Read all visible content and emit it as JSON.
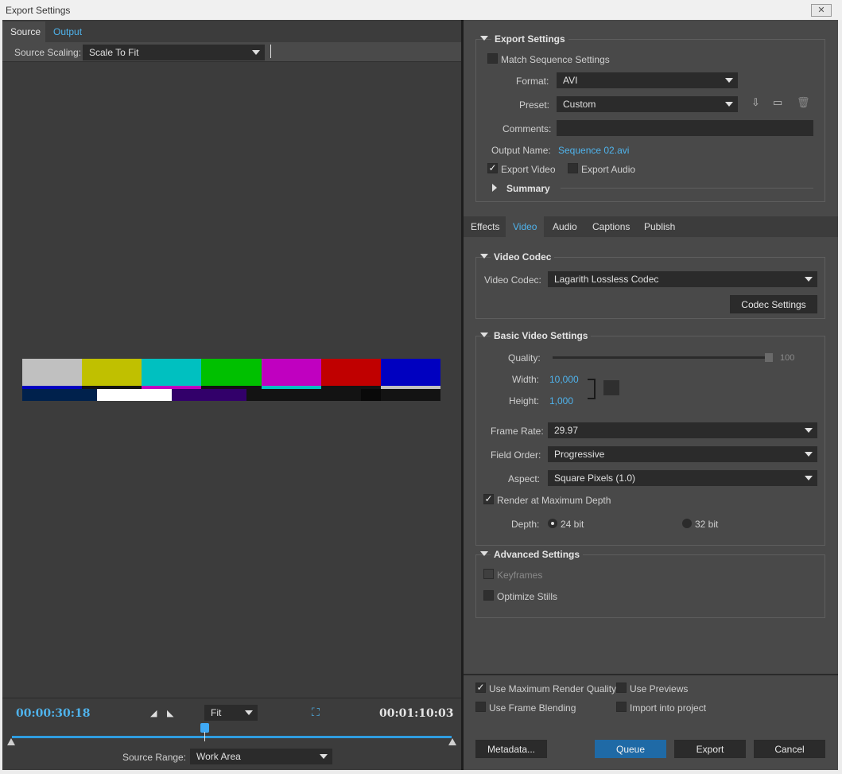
{
  "window": {
    "title": "Export Settings",
    "close_label": "✕"
  },
  "left": {
    "tabs": [
      {
        "label": "Source"
      },
      {
        "label": "Output"
      }
    ],
    "source_scaling": {
      "label": "Source Scaling:",
      "value": "Scale To Fit"
    },
    "transport": {
      "current_time": "00:00:30:18",
      "duration": "00:01:10:03",
      "zoom": "Fit",
      "source_range_label": "Source Range:",
      "source_range_value": "Work Area"
    }
  },
  "export_settings": {
    "section_title": "Export Settings",
    "match_sequence_label": "Match Sequence Settings",
    "format_label": "Format:",
    "format_value": "AVI",
    "preset_label": "Preset:",
    "preset_value": "Custom",
    "comments_label": "Comments:",
    "comments_value": "",
    "output_name_label": "Output Name:",
    "output_name_value": "Sequence 02.avi",
    "export_video_label": "Export Video",
    "export_audio_label": "Export Audio",
    "summary_label": "Summary"
  },
  "settings_tabs": [
    {
      "label": "Effects"
    },
    {
      "label": "Video"
    },
    {
      "label": "Audio"
    },
    {
      "label": "Captions"
    },
    {
      "label": "Publish"
    }
  ],
  "video_codec": {
    "section_title": "Video Codec",
    "codec_label": "Video Codec:",
    "codec_value": "Lagarith Lossless Codec",
    "codec_settings_button": "Codec Settings"
  },
  "basic_video": {
    "section_title": "Basic Video Settings",
    "quality_label": "Quality:",
    "quality_value": "100",
    "width_label": "Width:",
    "width_value": "10,000",
    "height_label": "Height:",
    "height_value": "1,000",
    "frame_rate_label": "Frame Rate:",
    "frame_rate_value": "29.97",
    "field_order_label": "Field Order:",
    "field_order_value": "Progressive",
    "aspect_label": "Aspect:",
    "aspect_value": "Square Pixels (1.0)",
    "render_max_depth_label": "Render at Maximum Depth",
    "depth_label": "Depth:",
    "depth_24_label": "24 bit",
    "depth_32_label": "32 bit"
  },
  "advanced": {
    "section_title": "Advanced Settings",
    "keyframes_label": "Keyframes",
    "optimize_stills_label": "Optimize Stills"
  },
  "bottom": {
    "max_render_quality_label": "Use Maximum Render Quality",
    "use_previews_label": "Use Previews",
    "frame_blending_label": "Use Frame Blending",
    "import_project_label": "Import into project",
    "metadata_button": "Metadata...",
    "queue_button": "Queue",
    "export_button": "Export",
    "cancel_button": "Cancel"
  },
  "colors": {
    "accent": "#4fb3ec",
    "primary_button": "#1f6aa6",
    "panel": "#494949",
    "preview_bg": "#3c3c3c"
  }
}
